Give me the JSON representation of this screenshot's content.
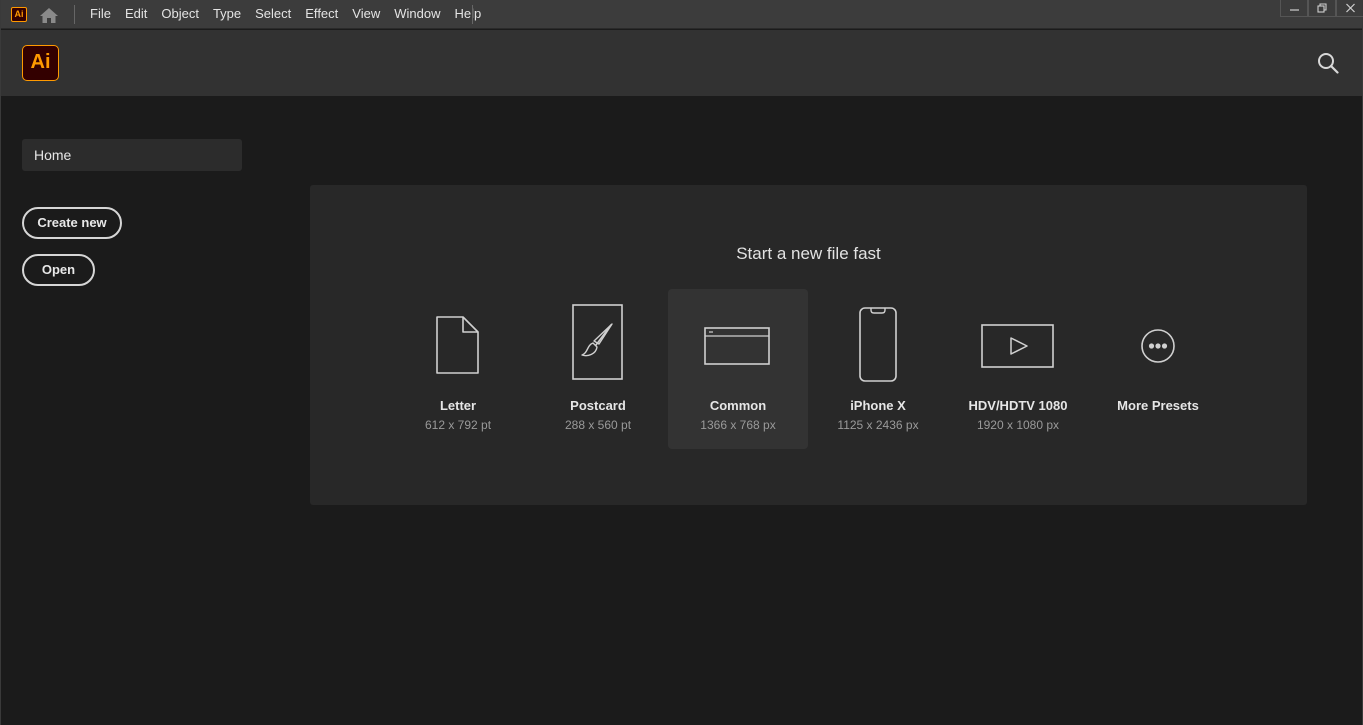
{
  "menubar": {
    "app_logo_text": "Ai",
    "items": [
      "File",
      "Edit",
      "Object",
      "Type",
      "Select",
      "Effect",
      "View",
      "Window",
      "Help"
    ]
  },
  "header": {
    "logo_text": "Ai",
    "logo_accent_color": "#ff9a00",
    "logo_bg_color": "#330000"
  },
  "sidebar": {
    "home_label": "Home",
    "create_new_label": "Create new",
    "open_label": "Open"
  },
  "main": {
    "title": "Start a new file fast",
    "presets": [
      {
        "name": "Letter",
        "size": "612 x 792 pt",
        "icon": "document-icon",
        "selected": false
      },
      {
        "name": "Postcard",
        "size": "288 x 560 pt",
        "icon": "brush-card-icon",
        "selected": false
      },
      {
        "name": "Common",
        "size": "1366 x 768 px",
        "icon": "browser-window-icon",
        "selected": true
      },
      {
        "name": "iPhone X",
        "size": "1125 x 2436 px",
        "icon": "phone-icon",
        "selected": false
      },
      {
        "name": "HDV/HDTV 1080",
        "size": "1920 x 1080 px",
        "icon": "video-play-icon",
        "selected": false
      },
      {
        "name": "More Presets",
        "size": "",
        "icon": "more-dots-icon",
        "selected": false
      }
    ]
  }
}
